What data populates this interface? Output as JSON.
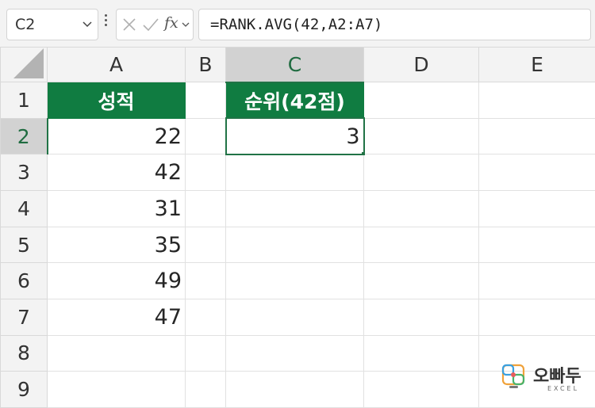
{
  "name_box": {
    "value": "C2"
  },
  "formula_bar": {
    "fx_label": "fx",
    "formula": "=RANK.AVG(42,A2:A7)"
  },
  "columns": [
    "A",
    "B",
    "C",
    "D",
    "E"
  ],
  "rows": [
    "1",
    "2",
    "3",
    "4",
    "5",
    "6",
    "7",
    "8",
    "9"
  ],
  "cells": {
    "A1": "성적",
    "C1": "순위(42점)",
    "A2": "22",
    "A3": "42",
    "A4": "31",
    "A5": "35",
    "A6": "49",
    "A7": "47",
    "C2": "3"
  },
  "selection": {
    "active_cell": "C2",
    "active_column": "C",
    "active_row": "2"
  },
  "colors": {
    "header_fill": "#107c41",
    "header_text": "#ffffff",
    "selection_accent": "#217346"
  },
  "watermark": {
    "brand": "오빠두",
    "sub": "EXCEL"
  }
}
